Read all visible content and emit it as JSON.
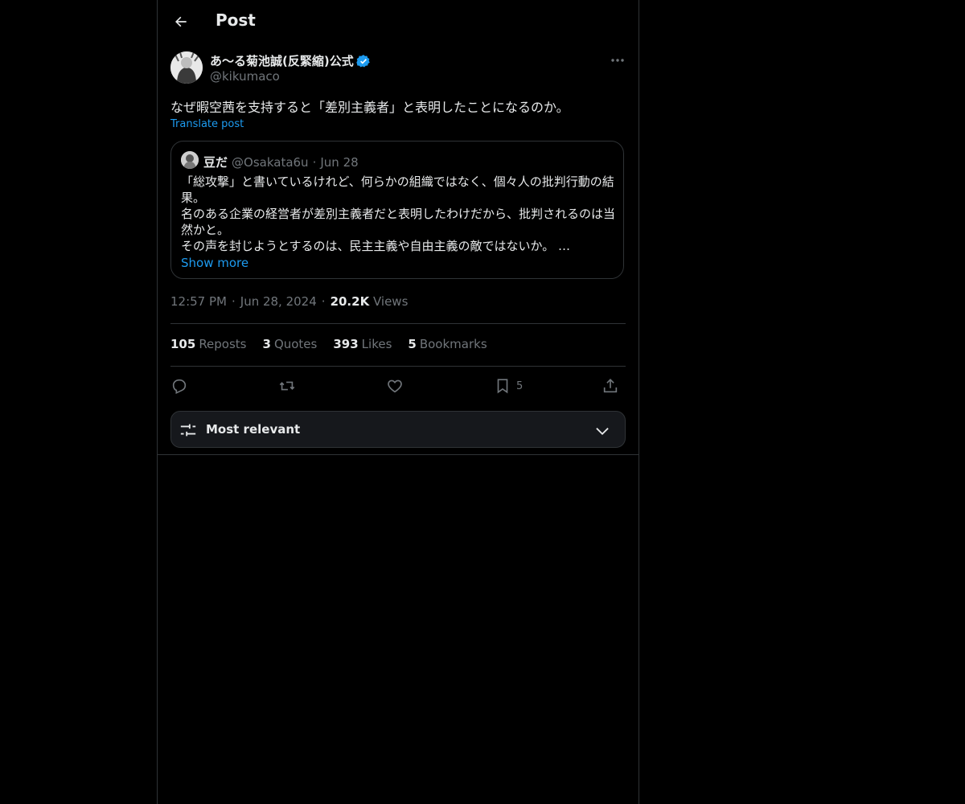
{
  "header": {
    "title": "Post"
  },
  "post": {
    "author_name": "あ〜る菊池誠(反緊縮)公式",
    "author_handle": "@kikumaco",
    "text": "なぜ暇空茜を支持すると「差別主義者」と表明したことになるのか。",
    "translate_label": "Translate post",
    "time": "12:57 PM",
    "date": "Jun 28, 2024",
    "views_count": "20.2K",
    "views_label": "Views",
    "meta_sep": "·"
  },
  "quote": {
    "name": "豆だ",
    "handle": "@Osakata6u",
    "sep": "·",
    "date": "Jun 28",
    "lines": [
      "「総攻撃」と書いているけれど、何らかの組織ではなく、個々人の批判行動の結果。",
      "名のある企業の経営者が差別主義者だと表明したわけだから、批判されるのは当然かと。",
      "その声を封じようとするのは、民主主義や自由主義の敵ではないか。 …"
    ],
    "show_more": "Show more"
  },
  "stats": [
    {
      "count": "105",
      "label": "Reposts"
    },
    {
      "count": "3",
      "label": "Quotes"
    },
    {
      "count": "393",
      "label": "Likes"
    },
    {
      "count": "5",
      "label": "Bookmarks"
    }
  ],
  "actions": {
    "icons": [
      "reply-icon",
      "repost-icon",
      "like-icon",
      "bookmark-icon",
      "share-icon"
    ],
    "bookmark_count": "5"
  },
  "sort": {
    "label": "Most relevant"
  },
  "colors": {
    "accent": "#1d9bf0",
    "text": "#e7e9ea",
    "muted": "#71767b",
    "border": "#2f3336",
    "background": "#000000"
  }
}
